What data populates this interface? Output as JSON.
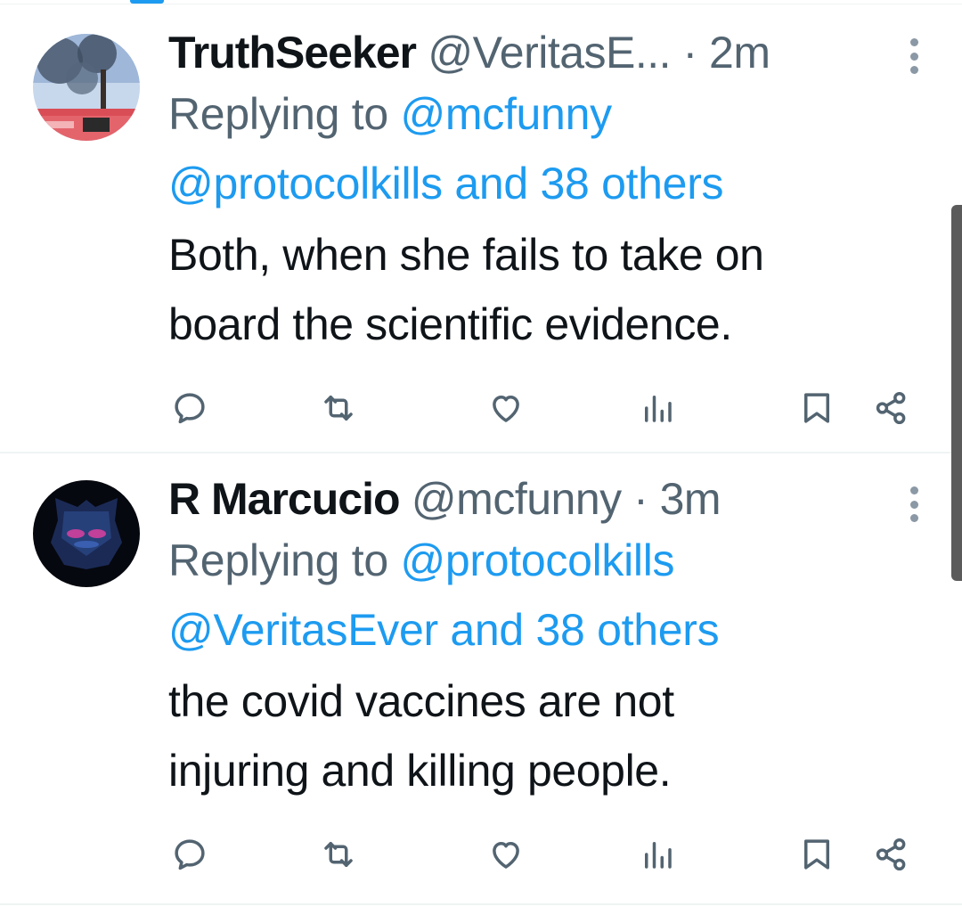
{
  "tweets": [
    {
      "name": "TruthSeeker",
      "handle": "@VeritasE...",
      "separator": "·",
      "time": "2m",
      "reply_prefix": "Replying to",
      "reply_mention_1": "@mcfunny",
      "reply_mention_2": "@protocolkills and 38 others",
      "body_line_1": "Both, when she fails to take on",
      "body_line_2": "board the scientific evidence."
    },
    {
      "name": "R Marcucio",
      "handle": "@mcfunny",
      "separator": "·",
      "time": "3m",
      "reply_prefix": "Replying to",
      "reply_mention_1": "@protocolkills",
      "reply_mention_2": "@VeritasEver and 38 others",
      "body_line_1": "the covid vaccines are not",
      "body_line_2": "injuring and killing people."
    }
  ],
  "icons": {
    "reply": "reply-icon",
    "retweet": "retweet-icon",
    "like": "heart-icon",
    "views": "views-icon",
    "bookmark": "bookmark-icon",
    "share": "share-icon",
    "more": "more-options-icon"
  },
  "colors": {
    "text": "#0f1419",
    "secondary": "#536471",
    "link": "#1d9bf0",
    "icon": "#536471",
    "divider": "#eff3f4"
  }
}
